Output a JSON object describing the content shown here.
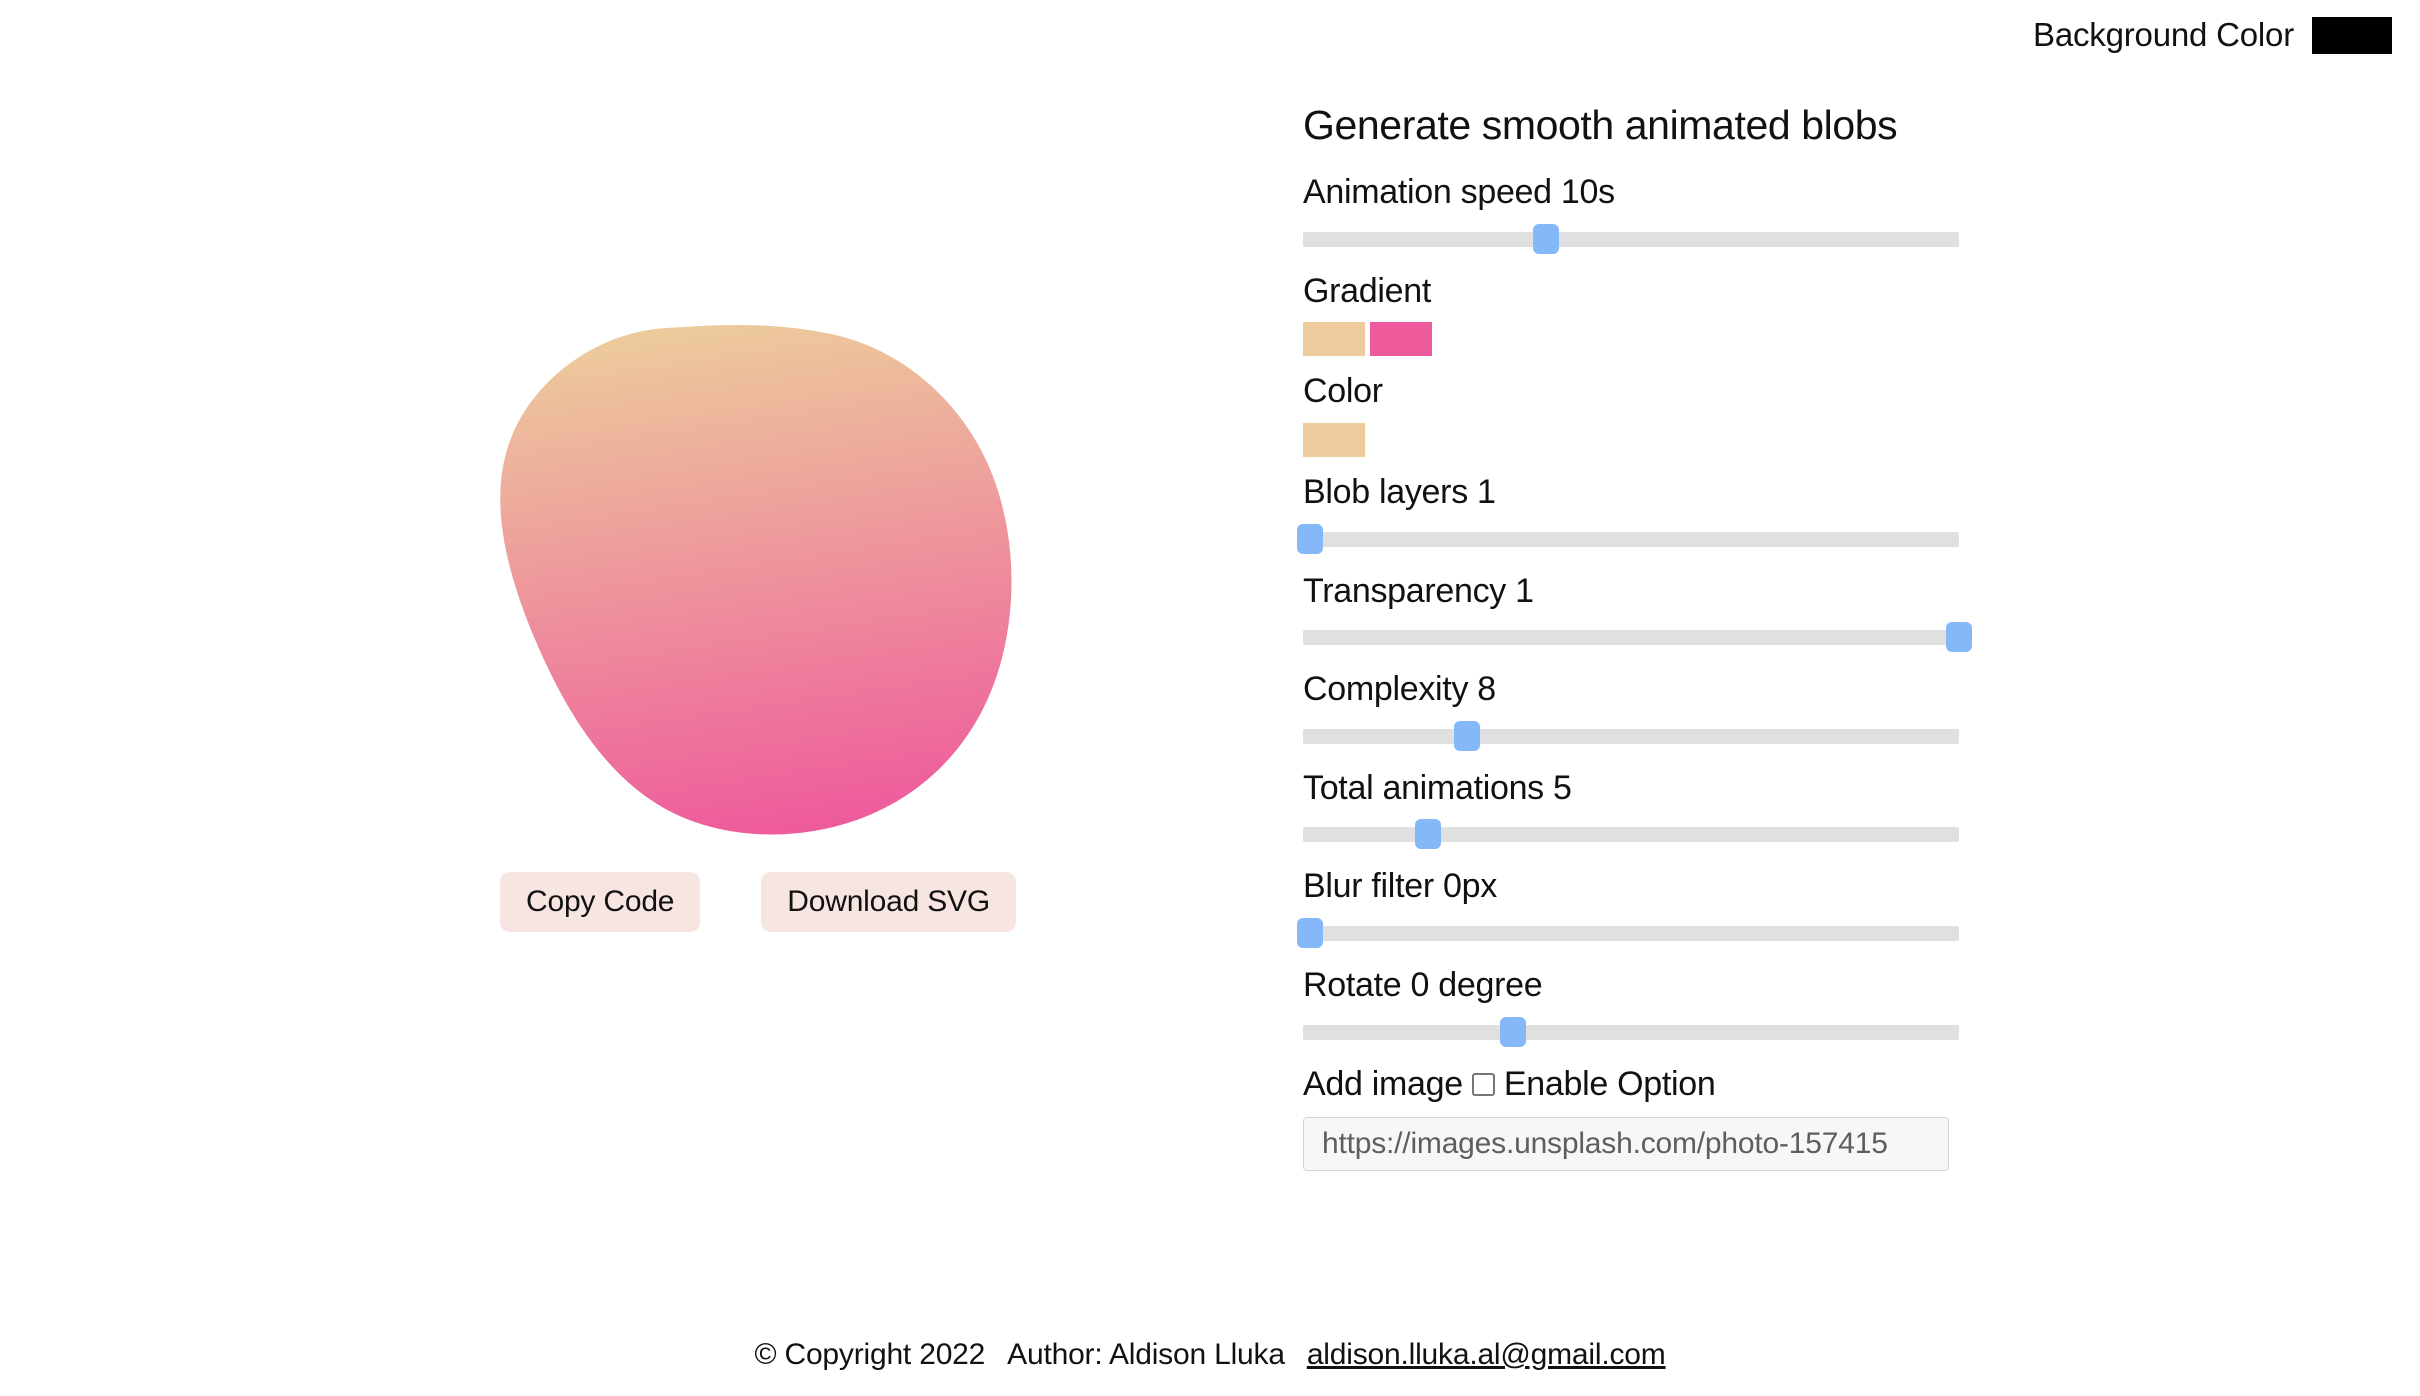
{
  "header": {
    "background_color_label": "Background Color",
    "background_color_value": "#000000"
  },
  "preview": {
    "blob_gradient_from": "#EDCB9C",
    "blob_gradient_to": "#EE5B9C",
    "copy_code_label": "Copy Code",
    "download_svg_label": "Download SVG"
  },
  "panel": {
    "title": "Generate smooth animated blobs",
    "animation_speed": {
      "label": "Animation speed 10s",
      "value": 10,
      "percent": 37
    },
    "gradient": {
      "label": "Gradient",
      "colors": [
        "#EDCB9C",
        "#EE5B9C"
      ]
    },
    "color": {
      "label": "Color",
      "value": "#EDCB9C"
    },
    "blob_layers": {
      "label": "Blob layers 1",
      "value": 1,
      "percent": 1
    },
    "transparency": {
      "label": "Transparency 1",
      "value": 1,
      "percent": 100
    },
    "complexity": {
      "label": "Complexity 8",
      "value": 8,
      "percent": 25
    },
    "total_animations": {
      "label": "Total animations 5",
      "value": 5,
      "percent": 19
    },
    "blur_filter": {
      "label": "Blur filter 0px",
      "value": 0,
      "percent": 1
    },
    "rotate": {
      "label": "Rotate 0 degree",
      "value": 0,
      "percent": 32
    },
    "add_image": {
      "label": "Add image",
      "checkbox_label": "Enable Option",
      "checked": false,
      "url_value": "https://images.unsplash.com/photo-157415",
      "url_placeholder": "https://images.unsplash.com/photo-157415"
    }
  },
  "footer": {
    "copyright": "© Copyright 2022",
    "author": "Author: Aldison Lluka",
    "email": "aldison.lluka.al@gmail.com"
  },
  "accent": {
    "slider_thumb": "#85B8F8",
    "slider_track": "#E0E0E0",
    "button_bg": "#F7E5E2"
  }
}
